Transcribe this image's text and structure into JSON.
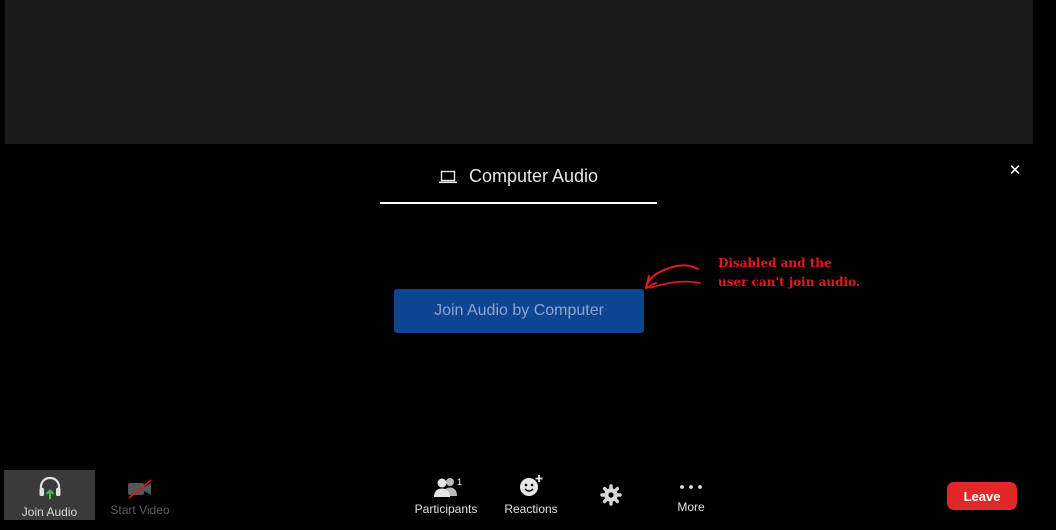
{
  "tab": {
    "label": "Computer Audio",
    "icon": "laptop-icon"
  },
  "close": {
    "symbol": "✕",
    "icon": "close-icon"
  },
  "join_button": {
    "label": "Join Audio by Computer",
    "background": "#0e4591",
    "state": "disabled"
  },
  "annotation": {
    "line1": "Disabled and the",
    "line2": "user can't join audio.",
    "color": "#e21b1b"
  },
  "toolbar": {
    "join_audio": {
      "label": "Join Audio",
      "icon": "headphones-icon"
    },
    "start_video": {
      "label": "Start Video",
      "icon": "video-off-icon"
    },
    "participants": {
      "label": "Participants",
      "count": "1",
      "icon": "participants-icon"
    },
    "reactions": {
      "label": "Reactions",
      "icon": "emoji-add-icon"
    },
    "settings": {
      "icon": "gear-icon"
    },
    "more": {
      "label": "More",
      "icon": "more-dots-icon"
    },
    "leave": {
      "label": "Leave",
      "color": "#e02828"
    }
  }
}
